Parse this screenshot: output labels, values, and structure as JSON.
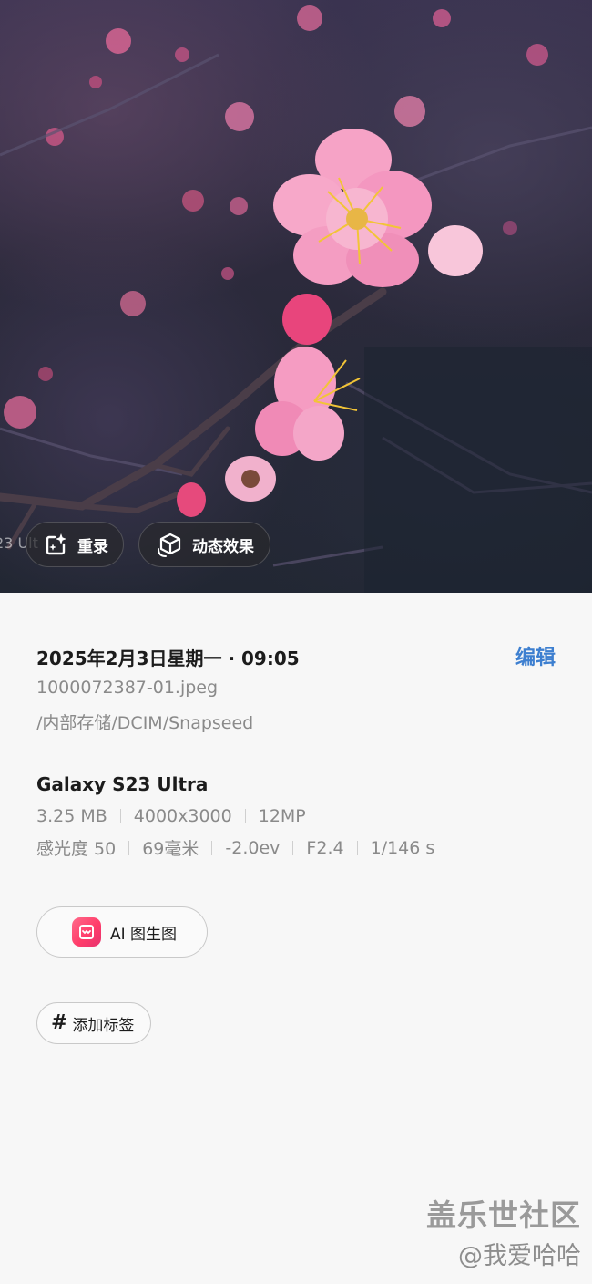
{
  "photo": {
    "edge_text": "23 Ult",
    "chips": {
      "remaster_label": "重录",
      "motion_label": "动态效果"
    }
  },
  "details": {
    "datetime": "2025年2月3日星期一 · 09:05",
    "edit_label": "编辑",
    "file_name": "1000072387-01.jpeg",
    "file_path": "/内部存储/DCIM/Snapseed",
    "device": "Galaxy S23 Ultra",
    "specs_row1": [
      "3.25 MB",
      "4000x3000",
      "12MP"
    ],
    "specs_row2": [
      "感光度 50",
      "69毫米",
      "-2.0ev",
      "F2.4",
      "1/146 s"
    ],
    "ai_button_label": "AI 图生图",
    "add_tag_label": "添加标签"
  },
  "watermark": {
    "brand": "盖乐世社区",
    "user": "@我爱哈哈"
  },
  "colors": {
    "accent": "#3d7fd0",
    "secondary_text": "#8a8a8a",
    "ai_logo": "#ff3d6a"
  },
  "icons": {
    "remaster": "sparkle-photo-icon",
    "motion": "motion-cube-icon",
    "ai_logo": "ai-app-icon",
    "tag": "hash-icon"
  }
}
